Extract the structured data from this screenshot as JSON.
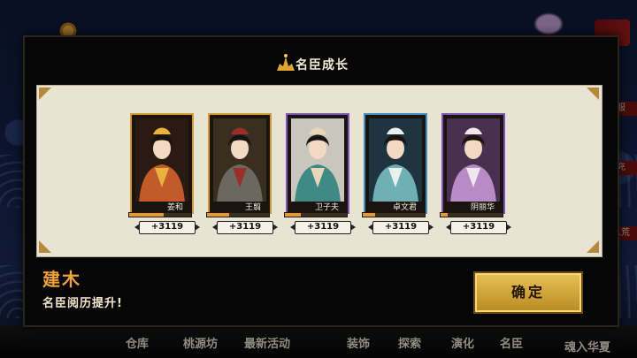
{
  "modal": {
    "title": "名臣成长",
    "unlock_title": "建木",
    "unlock_desc": "名臣阅历提升!",
    "confirm_label": "确定"
  },
  "ministers": [
    {
      "name": "姜和",
      "gain": "+3119",
      "frame": "gold",
      "progress": 0.55,
      "robe": "#c25a2a",
      "accent": "#e8b23e",
      "bg": "#2a1a12"
    },
    {
      "name": "王翦",
      "gain": "+3119",
      "frame": "gold",
      "progress": 0.35,
      "robe": "#6b6860",
      "accent": "#9a2f2a",
      "bg": "#3a2e20"
    },
    {
      "name": "卫子夫",
      "gain": "+3119",
      "frame": "purple",
      "progress": 0.25,
      "robe": "#3f8a84",
      "accent": "#e7d7b8",
      "bg": "#c9c6bd"
    },
    {
      "name": "卓文君",
      "gain": "+3119",
      "frame": "blue",
      "progress": 0.2,
      "robe": "#6fb0b5",
      "accent": "#e9f0ee",
      "bg": "#1e3540"
    },
    {
      "name": "阴丽华",
      "gain": "+3119",
      "frame": "purple",
      "progress": 0.12,
      "robe": "#b88bc6",
      "accent": "#f1e6ee",
      "bg": "#4a3050"
    }
  ],
  "background_nav": [
    {
      "label": "仓库"
    },
    {
      "label": "桃源坊"
    },
    {
      "label": "最新活动"
    },
    {
      "label": "装饰"
    },
    {
      "label": "探索"
    },
    {
      "label": "演化"
    },
    {
      "label": "名臣"
    },
    {
      "label": "魂入华夏"
    }
  ],
  "background_side_tabs": [
    {
      "label": "服"
    },
    {
      "label": "充"
    },
    {
      "label": "八荒"
    }
  ],
  "colors": {
    "accent_gold": "#e59a2a",
    "title_orange": "#f0a13a",
    "button_gold": "#d8ab3a"
  }
}
